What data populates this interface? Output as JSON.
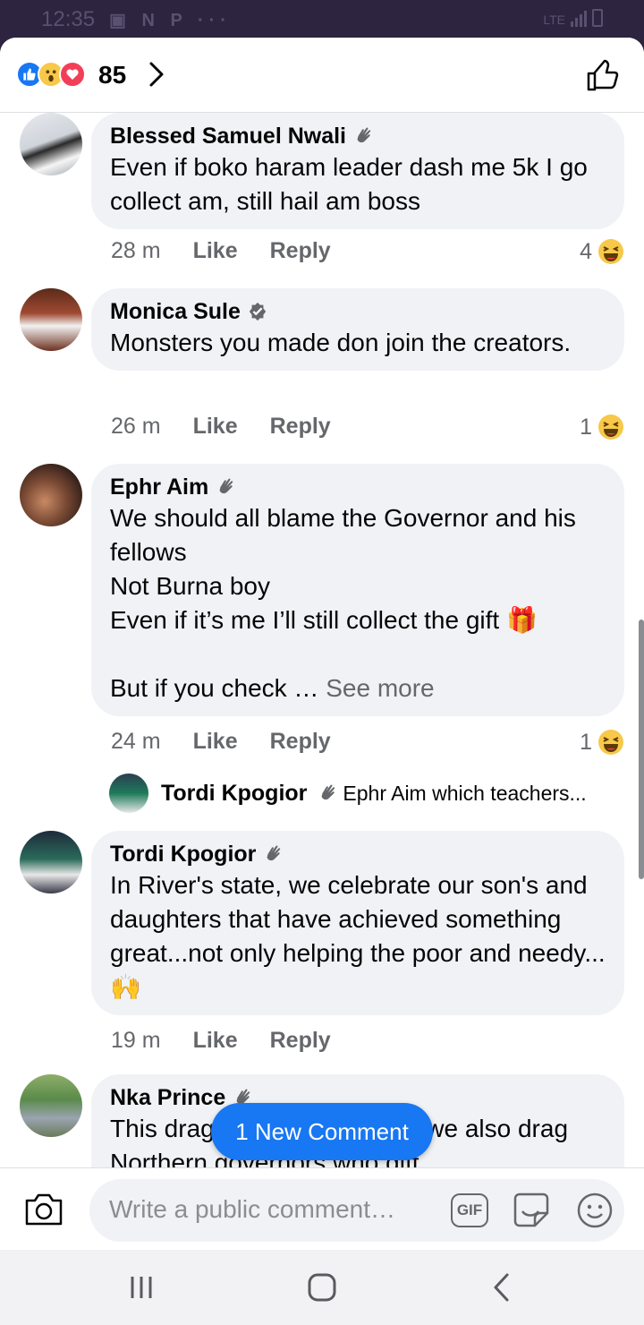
{
  "status_bar": {
    "time": "12:35",
    "notif_icons": "▣ N P ···",
    "network": "LTE"
  },
  "header": {
    "reaction_count": "85",
    "reactions": [
      "like-icon",
      "wow-icon",
      "love-icon"
    ]
  },
  "comments": [
    {
      "author": "Blessed Samuel Nwali",
      "badge": "wave-icon",
      "text": "Even if boko haram leader dash me 5k I go collect am, still hail am boss",
      "time": "28 m",
      "like_label": "Like",
      "reply_label": "Reply",
      "reaction_count": "4"
    },
    {
      "author": "Monica Sule",
      "badge": "verified-icon",
      "text": "Monsters you made don join the creators.",
      "time": "26 m",
      "like_label": "Like",
      "reply_label": "Reply",
      "reaction_count": "1"
    },
    {
      "author": "Ephr Aim",
      "badge": "wave-icon",
      "text": "We should all blame the Governor and his fellows\nNot Burna boy\nEven if it’s me I’ll still collect the gift 🎁\n\nBut if you check … ",
      "see_more": "See more",
      "time": "24 m",
      "like_label": "Like",
      "reply_label": "Reply",
      "reaction_count": "1",
      "reply_preview": {
        "author": "Tordi Kpogior",
        "text": "Ephr Aim which teachers..."
      }
    },
    {
      "author": "Tordi Kpogior",
      "badge": "wave-icon",
      "text": "In River's state, we celebrate our son's and daughters that have achieved something great...not only helping the poor and needy...🙌",
      "time": "19 m",
      "like_label": "Like",
      "reply_label": "Reply"
    },
    {
      "author": "Nka Prince",
      "badge": "wave-icon",
      "text": "This drag will be complete if we also drag Northern governors who gift"
    }
  ],
  "new_comment_label": "1 New Comment",
  "composer": {
    "placeholder": "Write a public comment…",
    "gif_label": "GIF"
  },
  "colors": {
    "accent": "#1877f2",
    "bubble": "#f0f2f5",
    "meta": "#65676b"
  }
}
